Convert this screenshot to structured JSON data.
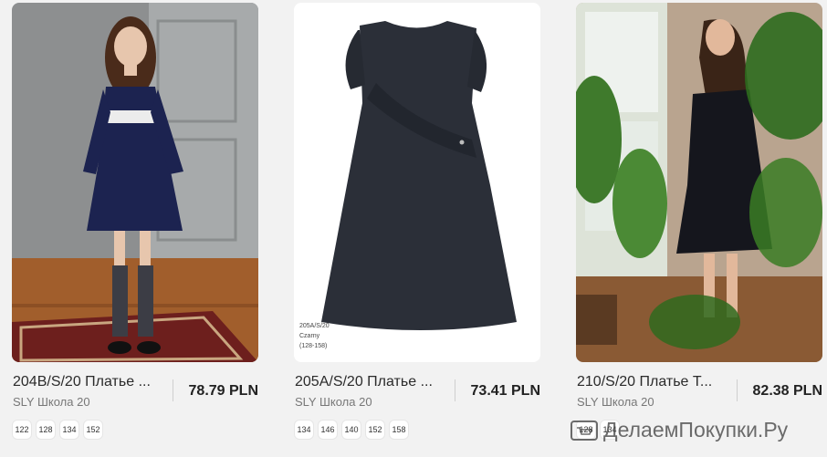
{
  "colors": {
    "background": "#f2f2f2",
    "price": "#222222",
    "brand": "#777777"
  },
  "products": [
    {
      "title": "204B/S/20 Платье ...",
      "brand": "SLY Школа 20",
      "price": "78.79 PLN",
      "sizes": [
        "122",
        "128",
        "134",
        "152"
      ]
    },
    {
      "title": "205A/S/20 Платье ...",
      "brand": "SLY Школа 20",
      "price": "73.41 PLN",
      "sizes": [
        "134",
        "146",
        "140",
        "152",
        "158"
      ],
      "photo_label": [
        "205A/S/20",
        "Czarny",
        "(128-158)"
      ]
    },
    {
      "title": "210/S/20 Платье Т...",
      "brand": "SLY Школа 20",
      "price": "82.38 PLN",
      "sizes": [
        "128",
        "134"
      ]
    }
  ],
  "watermark": {
    "text": "ДелаемПокупки.Ру",
    "icon": "cart-icon"
  }
}
